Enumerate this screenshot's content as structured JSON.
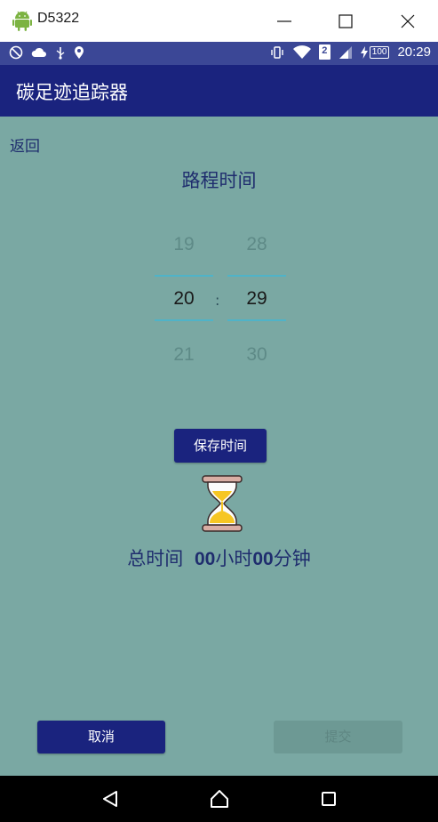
{
  "window": {
    "title": "D5322",
    "icon": "android-icon",
    "controls": [
      "minimize-icon",
      "maximize-icon",
      "close-icon"
    ]
  },
  "status_bar": {
    "left_icons": [
      "airplane-off-icon",
      "cloud-icon",
      "usb-icon",
      "location-icon"
    ],
    "right_icons": [
      "vibrate-icon",
      "wifi-icon",
      "sim-2-icon",
      "signal-icon",
      "battery-charging-icon"
    ],
    "sim_slot": "2",
    "battery": "100",
    "time": "20:29"
  },
  "app_bar": {
    "title": "碳足迹追踪器"
  },
  "main": {
    "back_label": "返回",
    "section_title": "路程时间",
    "picker": {
      "hour": {
        "prev": "19",
        "current": "20",
        "next": "21"
      },
      "separator": ":",
      "minute": {
        "prev": "28",
        "current": "29",
        "next": "30"
      }
    },
    "save_label": "保存时间",
    "hourglass_icon": "hourglass-icon",
    "total": {
      "prefix": "总时间",
      "hours": "00",
      "hours_unit": "小时",
      "minutes": "00",
      "minutes_unit": "分钟"
    },
    "cancel_label": "取消",
    "submit_label": "提交"
  },
  "nav_bar": {
    "buttons": [
      "back-triangle-icon",
      "home-icon",
      "recents-icon"
    ]
  },
  "colors": {
    "app_bar": "#1a237e",
    "status_bar": "#3b4796",
    "content_bg": "#7aa8a3",
    "button_primary": "#1a237e",
    "button_disabled": "#6d9994",
    "picker_divider": "#4fb3c8"
  }
}
